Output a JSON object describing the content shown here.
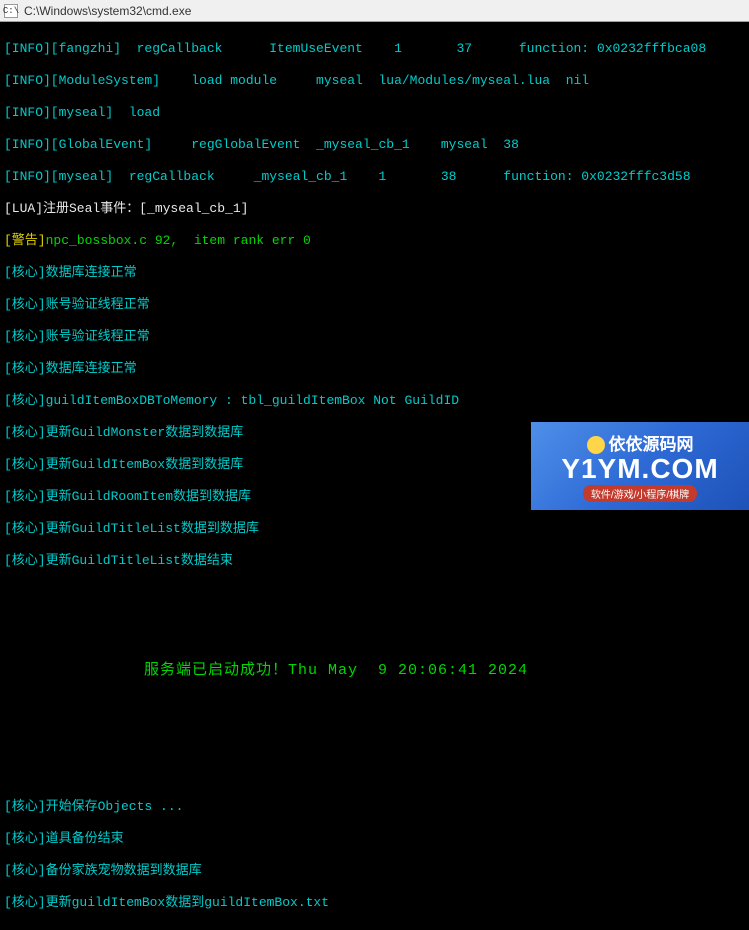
{
  "window": {
    "title": "C:\\Windows\\system32\\cmd.exe",
    "iconLabel": "C:\\"
  },
  "log": {
    "l1": "[INFO][fangzhi]  regCallback      ItemUseEvent    1       37      function: 0x0232fffbca08",
    "l2": "[INFO][ModuleSystem]    load module     myseal  lua/Modules/myseal.lua  nil",
    "l3": "[INFO][myseal]  load",
    "l4": "[INFO][GlobalEvent]     regGlobalEvent  _myseal_cb_1    myseal  38",
    "l5": "[INFO][myseal]  regCallback     _myseal_cb_1    1       38      function: 0x0232fffc3d58",
    "l6": "[LUA]注册Seal事件：[_myseal_cb_1]",
    "l7_warn": "[警告]",
    "l7_rest": "npc_bossbox.c 92,  item rank err 0",
    "l8": "[核心]数据库连接正常",
    "l9": "[核心]账号验证线程正常",
    "l10": "[核心]账号验证线程正常",
    "l11": "[核心]数据库连接正常",
    "l12": "[核心]guildItemBoxDBToMemory : tbl_guildItemBox Not GuildID",
    "l13": "[核心]更新GuildMonster数据到数据库",
    "l14": "[核心]更新GuildItemBox数据到数据库",
    "l15": "[核心]更新GuildRoomItem数据到数据库",
    "l16": "[核心]更新GuildTitleList数据到数据库",
    "l17": "[核心]更新GuildTitleList数据结束",
    "banner": "服务端已启动成功！Thu May  9 20:06:41 2024",
    "b1": "[核心]开始保存Objects ...",
    "b2": "[核心]道具备份结束",
    "b3": "[核心]备份家族宠物数据到数据库",
    "b4": "[核心]更新guildItemBox数据到guildItemBox.txt"
  },
  "watermark": {
    "top": "依依源码网",
    "site": "Y1YM.COM",
    "sub": "软件/游戏/小程序/棋牌"
  }
}
